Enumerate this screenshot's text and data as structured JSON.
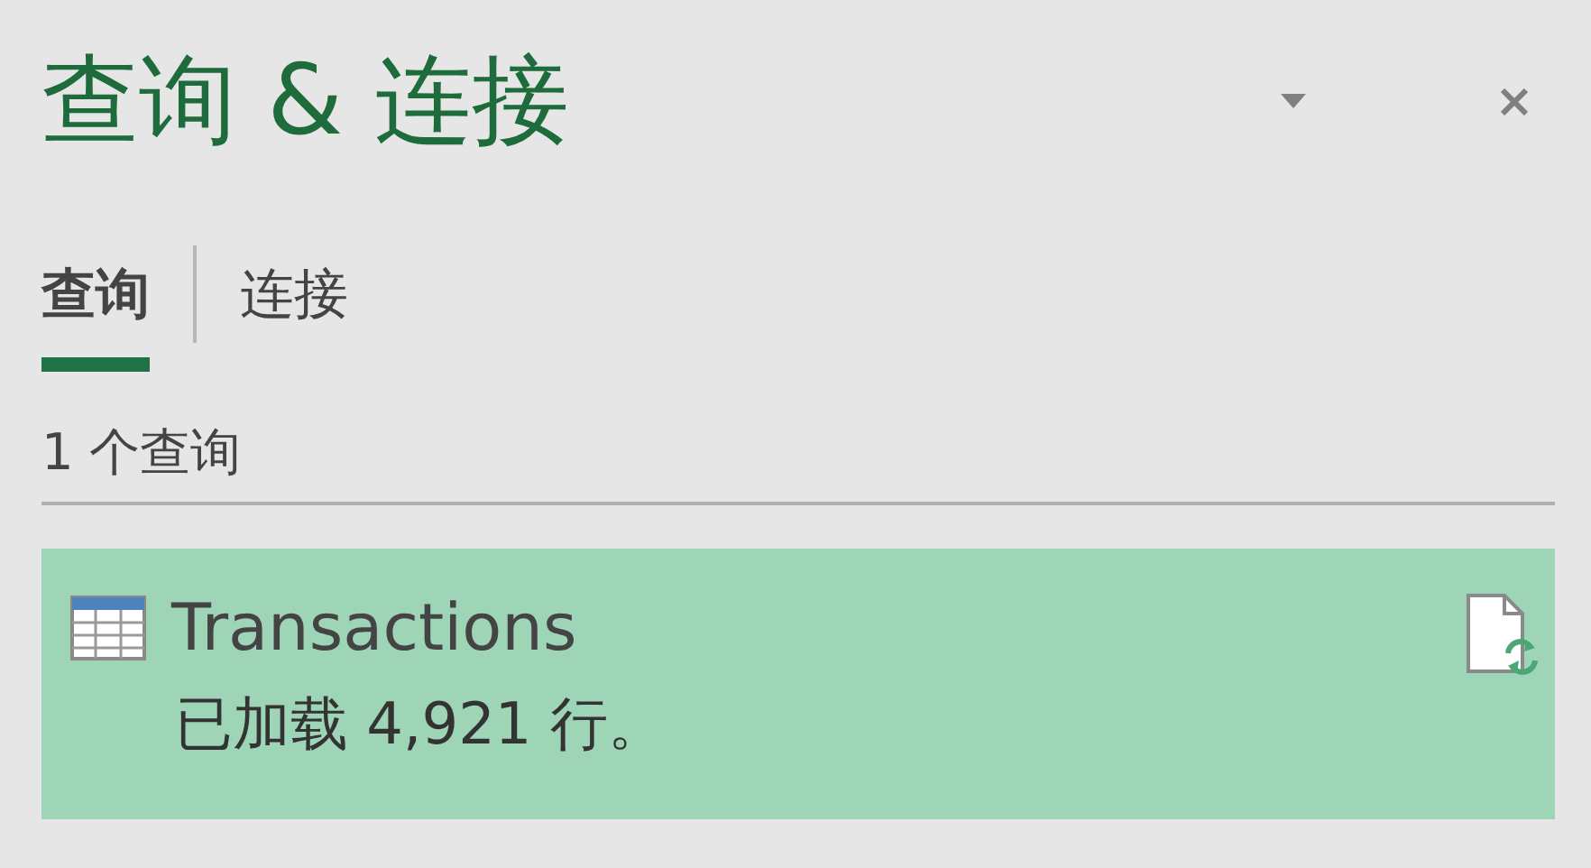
{
  "pane": {
    "title": "查询 & 连接"
  },
  "tabs": [
    {
      "label": "查询",
      "selected": true
    },
    {
      "label": "连接",
      "selected": false
    }
  ],
  "count_label": "1 个查询",
  "queries": [
    {
      "name": "Transactions",
      "status": "已加载 4,921 行。",
      "selected": true
    }
  ]
}
